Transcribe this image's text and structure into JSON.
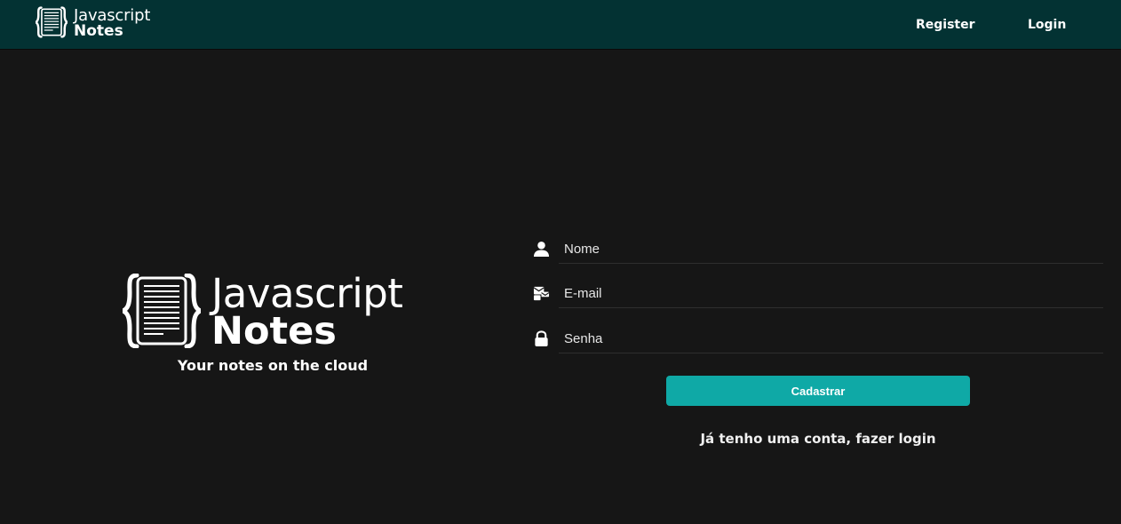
{
  "nav": {
    "logo_line1": "Javascript",
    "logo_line2": "Notes",
    "register_label": "Register",
    "login_label": "Login"
  },
  "hero": {
    "logo_line1": "Javascript",
    "logo_line2": "Notes",
    "tagline": "Your notes on the cloud"
  },
  "form": {
    "name_placeholder": "Nome",
    "email_placeholder": "E-mail",
    "password_placeholder": "Senha",
    "name_icon": "user-icon",
    "email_icon": "mail-icon",
    "password_icon": "lock-icon",
    "submit_label": "Cadastrar",
    "login_link": "Já tenho uma conta, fazer login"
  },
  "colors": {
    "navbar": "#033233",
    "background": "#161616",
    "accent": "#0fa9a6"
  }
}
